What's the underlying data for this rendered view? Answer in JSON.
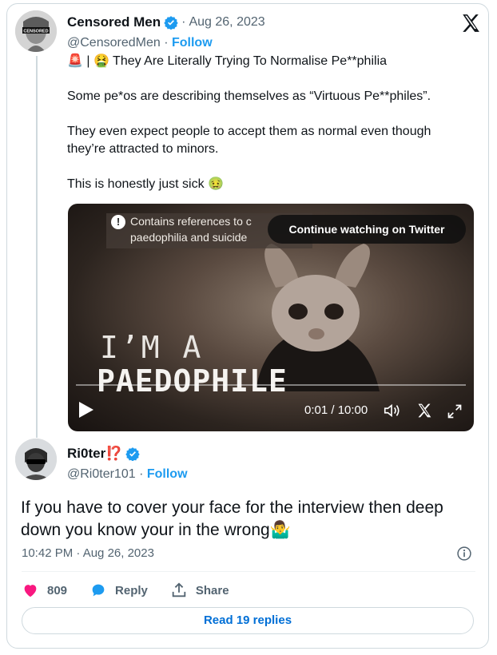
{
  "original_tweet": {
    "author_name": "Censored Men",
    "handle": "@CensoredMen",
    "separator": "·",
    "date": "Aug 26, 2023",
    "follow_label": "Follow",
    "avatar_badge": "CENSORED",
    "headline": "🚨 | 🤮 They Are Literally Trying To Normalise Pe**philia",
    "paragraphs": [
      "Some pe*os are describing themselves as “Virtuous Pe**philes”.",
      "They even expect people to accept them as normal even though they’re attracted to minors.",
      "This is honestly just sick 🤢"
    ]
  },
  "video": {
    "warning_line1": "Contains references to c",
    "warning_line2": "paedophilia and suicide",
    "continue_label": "Continue watching on Twitter",
    "overlay_line1": "I’M A",
    "overlay_line2": "PAEDOPHILE",
    "time": "0:01 / 10:00",
    "progress": 0.0017
  },
  "reply": {
    "author_name": "Ri0ter⁉️",
    "handle": "@Ri0ter101",
    "separator": "·",
    "follow_label": "Follow",
    "text": "If you have to cover your face for the interview then deep down you know your in the wrong🤷‍♂️",
    "timestamp": "10:42 PM · Aug 26, 2023",
    "likes": "809",
    "reply_label": "Reply",
    "share_label": "Share",
    "read_replies_label": "Read 19 replies"
  },
  "colors": {
    "accent": "#1d9bf0",
    "like": "#f91880",
    "link": "#006fd6",
    "muted": "#536471"
  },
  "icons": [
    "verified-badge-icon",
    "x-logo-icon",
    "warning-icon",
    "play-icon",
    "volume-icon",
    "x-video-icon",
    "fullscreen-icon",
    "info-icon",
    "heart-icon",
    "reply-bubble-icon",
    "share-icon"
  ]
}
